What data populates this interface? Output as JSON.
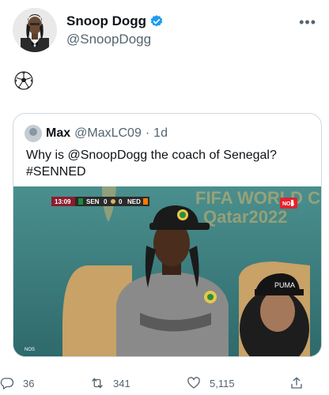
{
  "author": {
    "display_name": "Snoop Dogg",
    "handle": "@SnoopDogg",
    "verified": true
  },
  "post": {
    "text_icon": "soccer-ball-icon"
  },
  "quote": {
    "display_name": "Max",
    "handle": "@MaxLC09",
    "separator": "·",
    "time": "1d",
    "text_line1": "Why is @SnoopDogg the coach of Senegal?",
    "text_line2": "#SENNED"
  },
  "media": {
    "scoreboard_time": "13:09",
    "team_home": "SEN",
    "score_home": "0",
    "score_away": "0",
    "team_away": "NED",
    "broadcaster_badge": "NOS",
    "banner_line1": "FIFA WORLD CUP",
    "banner_line2": "Qatar2022",
    "corner_logo": "NOS"
  },
  "actions": {
    "replies": "36",
    "retweets": "341",
    "likes": "5,115"
  },
  "colors": {
    "verified_blue": "#1d9bf0",
    "secondary_text": "#536471",
    "border": "#cfd9de"
  }
}
